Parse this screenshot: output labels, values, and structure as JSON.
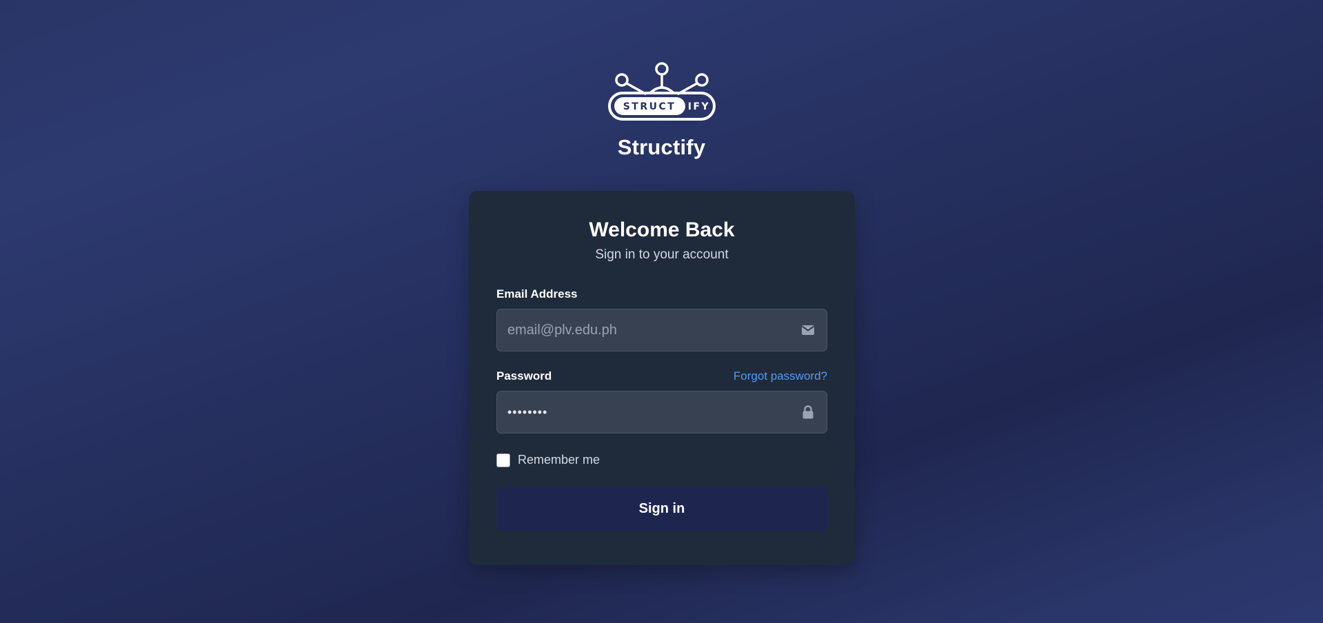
{
  "brand": {
    "logo_text_left": "STRUCT",
    "logo_text_right": "IFY",
    "name": "Structify"
  },
  "card": {
    "title": "Welcome Back",
    "subtitle": "Sign in to your account"
  },
  "email": {
    "label": "Email Address",
    "placeholder": "email@plv.edu.ph",
    "value": "",
    "icon": "envelope-icon"
  },
  "password": {
    "label": "Password",
    "forgot_label": "Forgot password?",
    "value": "••••••••",
    "icon": "lock-icon"
  },
  "remember": {
    "label": "Remember me",
    "checked": false
  },
  "submit": {
    "label": "Sign in"
  },
  "colors": {
    "card_bg": "#1f2a3b",
    "input_bg": "#374151",
    "link": "#4f9cf3",
    "button_bg": "#1e2650"
  }
}
